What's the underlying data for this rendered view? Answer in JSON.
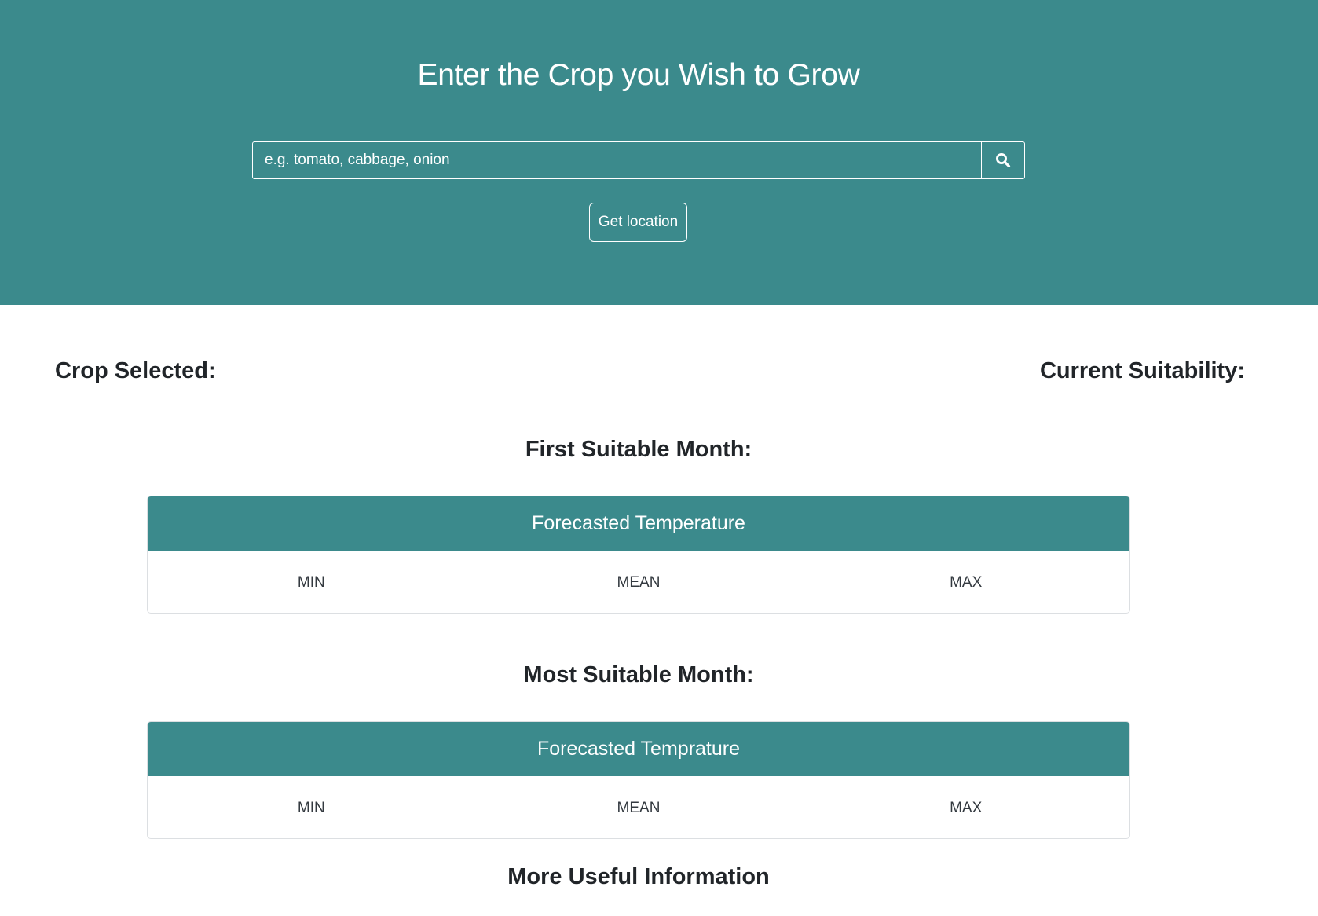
{
  "hero": {
    "title": "Enter the Crop you Wish to Grow",
    "search_placeholder": "e.g. tomato, cabbage, onion",
    "search_icon": "search-icon",
    "location_label": "Get location"
  },
  "summary": {
    "crop_selected_label": "Crop Selected:",
    "current_suitability_label": "Current Suitability:"
  },
  "first_month": {
    "heading": "First Suitable Month:",
    "card_title": "Forecasted Temperature",
    "columns": [
      "MIN",
      "MEAN",
      "MAX"
    ]
  },
  "most_month": {
    "heading": "Most Suitable Month:",
    "card_title": "Forecasted Temprature",
    "columns": [
      "MIN",
      "MEAN",
      "MAX"
    ]
  },
  "more_info": {
    "heading": "More Useful Information"
  },
  "colors": {
    "accent": "#3b8a8c",
    "text": "#212529"
  }
}
